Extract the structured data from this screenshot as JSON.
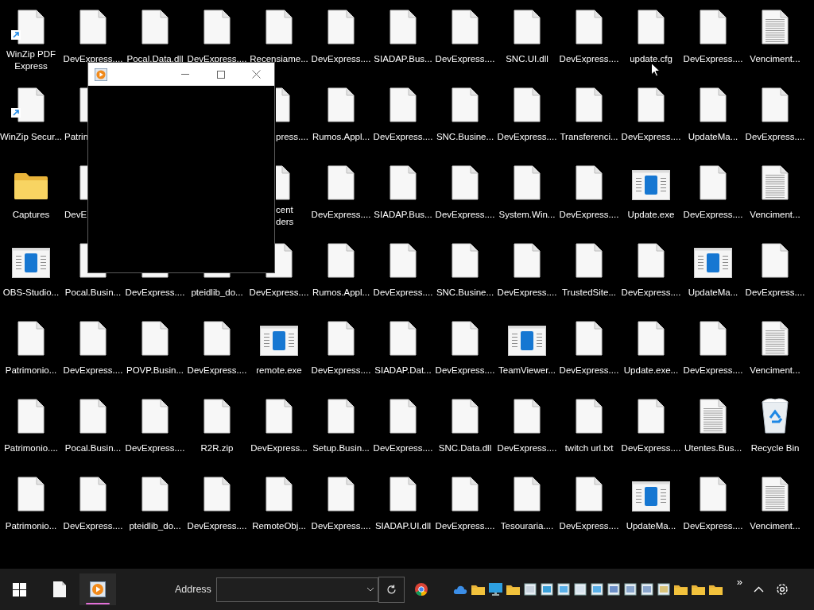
{
  "desktop": {
    "rows": [
      [
        {
          "kind": "file",
          "label": "WinZip PDF Express",
          "shortcut": true
        },
        {
          "kind": "file",
          "label": "DevExpress...."
        },
        {
          "kind": "file",
          "label": "Pocal.Data.dll"
        },
        {
          "kind": "file",
          "label": "DevExpress...."
        },
        {
          "kind": "file",
          "label": "Recensiame..."
        },
        {
          "kind": "file",
          "label": "DevExpress...."
        },
        {
          "kind": "file",
          "label": "SIADAP.Bus..."
        },
        {
          "kind": "file",
          "label": "DevExpress...."
        },
        {
          "kind": "file",
          "label": "SNC.UI.dll"
        },
        {
          "kind": "file",
          "label": "DevExpress...."
        },
        {
          "kind": "file",
          "label": "update.cfg"
        },
        {
          "kind": "file",
          "label": "DevExpress...."
        },
        {
          "kind": "text",
          "label": "Venciment..."
        }
      ],
      [
        {
          "kind": "file",
          "label": "WinZip Secur...",
          "shortcut": true
        },
        {
          "kind": "file",
          "label": "Patrin",
          "covered_right": true
        },
        {
          "kind": "covered"
        },
        {
          "kind": "covered"
        },
        {
          "kind": "file",
          "label": "press....",
          "covered_left": true
        },
        {
          "kind": "file",
          "label": "Rumos.Appl..."
        },
        {
          "kind": "file",
          "label": "DevExpress...."
        },
        {
          "kind": "file",
          "label": "SNC.Busine..."
        },
        {
          "kind": "file",
          "label": "DevExpress...."
        },
        {
          "kind": "file",
          "label": "Transferenci..."
        },
        {
          "kind": "file",
          "label": "DevExpress...."
        },
        {
          "kind": "file",
          "label": "UpdateMa..."
        },
        {
          "kind": "file",
          "label": "DevExpress...."
        }
      ],
      [
        {
          "kind": "folder",
          "label": "Captures"
        },
        {
          "kind": "file",
          "label": "DevE",
          "covered_right": true
        },
        {
          "kind": "covered"
        },
        {
          "kind": "covered"
        },
        {
          "kind": "file",
          "label": "cent\nders",
          "covered_left": true
        },
        {
          "kind": "file",
          "label": "DevExpress...."
        },
        {
          "kind": "file",
          "label": "SIADAP.Bus..."
        },
        {
          "kind": "file",
          "label": "DevExpress...."
        },
        {
          "kind": "file",
          "label": "System.Win..."
        },
        {
          "kind": "file",
          "label": "DevExpress...."
        },
        {
          "kind": "app",
          "label": "Update.exe"
        },
        {
          "kind": "file",
          "label": "DevExpress...."
        },
        {
          "kind": "text",
          "label": "Venciment..."
        }
      ],
      [
        {
          "kind": "app",
          "label": "OBS-Studio..."
        },
        {
          "kind": "file",
          "label": "Pocal.Busin..."
        },
        {
          "kind": "file",
          "label": "DevExpress...."
        },
        {
          "kind": "file",
          "label": "pteidlib_do..."
        },
        {
          "kind": "file",
          "label": "DevExpress...."
        },
        {
          "kind": "file",
          "label": "Rumos.Appl..."
        },
        {
          "kind": "file",
          "label": "DevExpress...."
        },
        {
          "kind": "file",
          "label": "SNC.Busine..."
        },
        {
          "kind": "file",
          "label": "DevExpress...."
        },
        {
          "kind": "file",
          "label": "TrustedSite..."
        },
        {
          "kind": "file",
          "label": "DevExpress...."
        },
        {
          "kind": "app",
          "label": "UpdateMa..."
        },
        {
          "kind": "file",
          "label": "DevExpress...."
        }
      ],
      [
        {
          "kind": "file",
          "label": "Patrimonio..."
        },
        {
          "kind": "file",
          "label": "DevExpress...."
        },
        {
          "kind": "file",
          "label": "POVP.Busin..."
        },
        {
          "kind": "file",
          "label": "DevExpress...."
        },
        {
          "kind": "app",
          "label": "remote.exe"
        },
        {
          "kind": "file",
          "label": "DevExpress...."
        },
        {
          "kind": "file",
          "label": "SIADAP.Dat..."
        },
        {
          "kind": "file",
          "label": "DevExpress...."
        },
        {
          "kind": "app",
          "label": "TeamViewer..."
        },
        {
          "kind": "file",
          "label": "DevExpress...."
        },
        {
          "kind": "file",
          "label": "Update.exe..."
        },
        {
          "kind": "file",
          "label": "DevExpress...."
        },
        {
          "kind": "text",
          "label": "Venciment..."
        }
      ],
      [
        {
          "kind": "file",
          "label": "Patrimonio...."
        },
        {
          "kind": "file",
          "label": "Pocal.Busin..."
        },
        {
          "kind": "file",
          "label": "DevExpress...."
        },
        {
          "kind": "file",
          "label": "R2R.zip"
        },
        {
          "kind": "file",
          "label": "DevExpress..."
        },
        {
          "kind": "file",
          "label": "Setup.Busin..."
        },
        {
          "kind": "file",
          "label": "DevExpress...."
        },
        {
          "kind": "file",
          "label": "SNC.Data.dll"
        },
        {
          "kind": "file",
          "label": "DevExpress...."
        },
        {
          "kind": "file",
          "label": "twitch url.txt"
        },
        {
          "kind": "file",
          "label": "DevExpress...."
        },
        {
          "kind": "text",
          "label": "Utentes.Bus..."
        },
        {
          "kind": "recycle",
          "label": "Recycle Bin"
        }
      ],
      [
        {
          "kind": "file",
          "label": "Patrimonio..."
        },
        {
          "kind": "file",
          "label": "DevExpress...."
        },
        {
          "kind": "file",
          "label": "pteidlib_do..."
        },
        {
          "kind": "file",
          "label": "DevExpress...."
        },
        {
          "kind": "file",
          "label": "RemoteObj..."
        },
        {
          "kind": "file",
          "label": "DevExpress...."
        },
        {
          "kind": "file",
          "label": "SIADAP.UI.dll"
        },
        {
          "kind": "file",
          "label": "DevExpress...."
        },
        {
          "kind": "file",
          "label": "Tesouraria...."
        },
        {
          "kind": "file",
          "label": "DevExpress...."
        },
        {
          "kind": "app",
          "label": "UpdateMa..."
        },
        {
          "kind": "file",
          "label": "DevExpress...."
        },
        {
          "kind": "text",
          "label": "Venciment..."
        }
      ]
    ]
  },
  "taskbar": {
    "apps": [
      {
        "kind": "file",
        "active": false
      },
      {
        "kind": "player",
        "active": true
      }
    ],
    "address": {
      "label": "Address"
    },
    "overflow": "»"
  }
}
